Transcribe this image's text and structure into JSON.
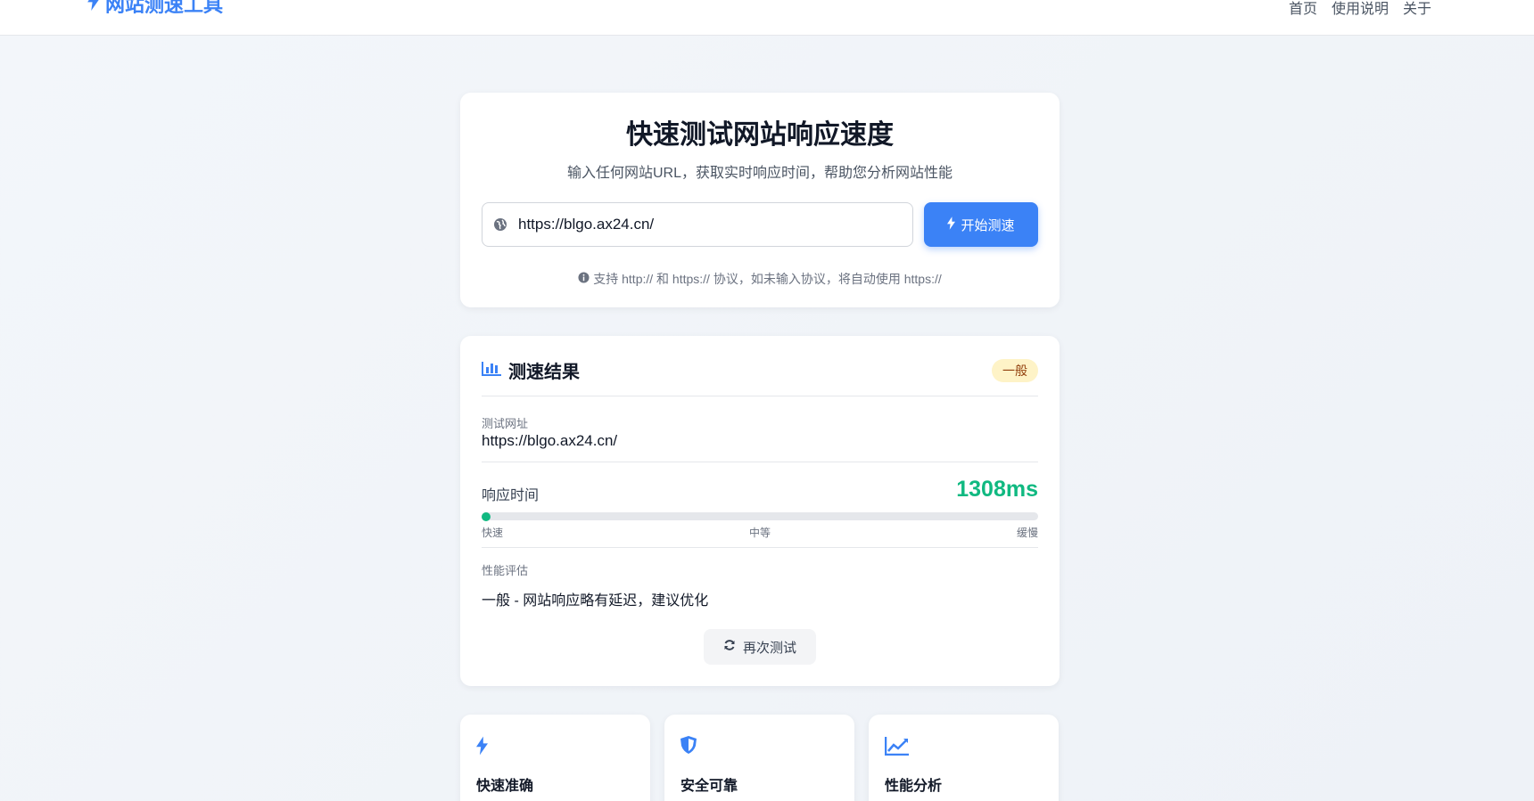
{
  "header": {
    "brand": "网站测速工具",
    "nav": [
      "首页",
      "使用说明",
      "关于"
    ]
  },
  "hero": {
    "title": "快速测试网站响应速度",
    "subtitle": "输入任何网站URL，获取实时响应时间，帮助您分析网站性能",
    "url_value": "https://blgo.ax24.cn/",
    "start_label": "开始测速",
    "hint": "支持 http:// 和 https:// 协议，如未输入协议，将自动使用 https://"
  },
  "result": {
    "title": "测速结果",
    "badge": "一般",
    "url_label": "测试网址",
    "url_value": "https://blgo.ax24.cn/",
    "rt_label": "响应时间",
    "rt_value": "1308ms",
    "scale": [
      "快速",
      "中等",
      "缓慢"
    ],
    "perf_label": "性能评估",
    "perf_text": "一般 - 网站响应略有延迟，建议优化",
    "retry_label": "再次测试"
  },
  "features": [
    {
      "title": "快速准确",
      "icon": "bolt-icon"
    },
    {
      "title": "安全可靠",
      "icon": "shield-icon"
    },
    {
      "title": "性能分析",
      "icon": "chart-line-icon"
    }
  ],
  "colors": {
    "accent": "#3b82f6",
    "success": "#10b981",
    "badge_bg": "#fef3c7",
    "badge_text": "#92400e"
  }
}
